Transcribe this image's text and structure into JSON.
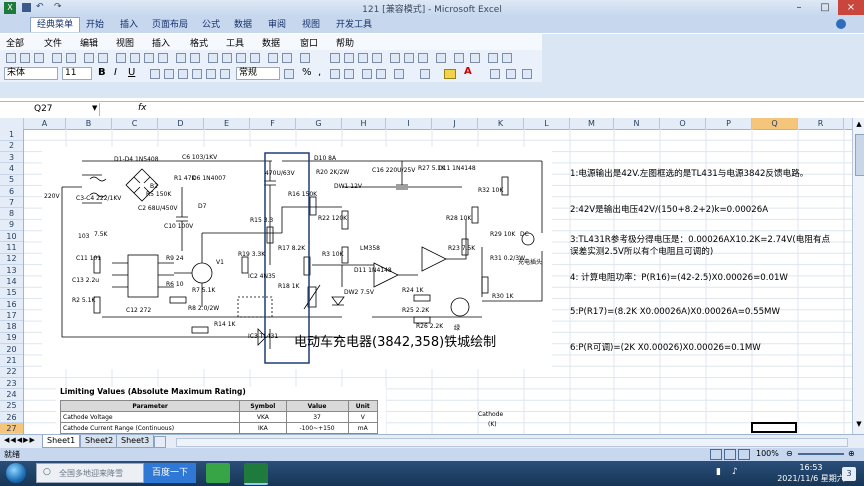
{
  "window": {
    "title": "121  [兼容模式] - Microsoft Excel",
    "controls": [
      "–",
      "□",
      "×"
    ]
  },
  "ribbon_tabs": [
    "经典菜单",
    "开始",
    "插入",
    "页面布局",
    "公式",
    "数据",
    "审阅",
    "视图",
    "开发工具"
  ],
  "classic_menu": [
    "全部",
    "文件",
    "编辑",
    "视图",
    "插入",
    "格式",
    "工具",
    "数据",
    "窗口",
    "帮助"
  ],
  "toolbar": {
    "font_name": "宋体",
    "font_size": "11",
    "bold": "B",
    "italic": "I",
    "underline": "U",
    "number_format": "常规",
    "percent": "%",
    "comma": ",",
    "font_color_letter": "A"
  },
  "formula_bar": {
    "name_box": "Q27",
    "fx": "fx",
    "value": ""
  },
  "columns": [
    "A",
    "B",
    "C",
    "D",
    "E",
    "F",
    "G",
    "H",
    "I",
    "J",
    "K",
    "L",
    "M",
    "N",
    "O",
    "P",
    "Q",
    "R"
  ],
  "selected_column": "Q",
  "rows": [
    "1",
    "2",
    "3",
    "4",
    "5",
    "6",
    "7",
    "8",
    "9",
    "10",
    "11",
    "12",
    "13",
    "14",
    "15",
    "16",
    "17",
    "18",
    "19",
    "20",
    "21",
    "22",
    "23",
    "24",
    "25",
    "26",
    "27"
  ],
  "notes": [
    "1:电源输出是42V.左图框选的是TL431与电源3842反馈电路。",
    "2:42V是输出电压42V/(150+8.2+2)k=0.00026A",
    "3:TL431R参考极分得电压是：0.00026AX10.2K=2.74V(电阻有点",
    "误差实测2.5V所以有个电阻且可调的)",
    "4: 计算电阻功率：P(R16)=(42-2.5)X0.00026=0.01W",
    "5:P(R17)=(8.2K X0.00026A)X0.00026A=0.55MW",
    "6:P(R可调)=(2K X0.00026)X0.00026=0.1MW"
  ],
  "schematic": {
    "caption": "电动车充电器(3842,358)铁城绘制",
    "labels": [
      "220V",
      "D1-D4 1N5408",
      "C6 103/1KV",
      "470U/63V",
      "D10 8A",
      "R20 2K/2W",
      "C16 220U/25V",
      "R27 5.1K",
      "D11 1N4148",
      "R32 10K",
      "R28 10K",
      "C3-C4 222/1KV",
      "B2",
      "R1 47K",
      "R5 150K",
      "D6 1N4007",
      "C2 68U/450V",
      "C10 100V",
      "D7",
      "R16 150K",
      "DW1 12V",
      "R15 3.3",
      "R17 8.2K",
      "R22 120K",
      "LM358",
      "R29 10K",
      "DC",
      "R31 0.2/3W",
      "充电插头",
      "103",
      "7.5K",
      "C11 101",
      "R9 24",
      "V1",
      "R19 3.3K",
      "R6 10",
      "R7 5.1K",
      "R8 2.0/2W",
      "IC2 4N35",
      "R18 1K",
      "R14 1K",
      "C13 2.2u",
      "R2 5.1K",
      "C12 272",
      "IC3 TL431",
      "DW2 7.5V",
      "D11 1N4148",
      "R24 1K",
      "R25 2.2K",
      "R23 7.5K",
      "R30 1K",
      "R3 10K",
      "R26 2.2K",
      "绿"
    ]
  },
  "limiting_values": {
    "title": "Limiting Values (Absolute Maximum Rating)",
    "headers": [
      "Parameter",
      "Symbol",
      "Value",
      "Unit"
    ],
    "rows": [
      [
        "Cathode Voltage",
        "VKA",
        "37",
        "V"
      ],
      [
        "Cathode Current Range (Continuous)",
        "IKA",
        "-100~+150",
        "mA"
      ]
    ],
    "cathode_label": "Cathode",
    "cathode_k": "(K)"
  },
  "sheet_tabs": [
    "Sheet1",
    "Sheet2",
    "Sheet3"
  ],
  "status": {
    "mode": "就绪",
    "zoom": "100%"
  },
  "taskbar": {
    "search_placeholder": "全国多地迎来降雪",
    "baidu_button": "百度一下",
    "time": "16:53",
    "date": "2021/11/6 星期六",
    "notification_count": "3"
  },
  "colors": {
    "ribbon_bg": "#c6d7ee",
    "selection": "#f6c57c",
    "highlight_box": "#1f3d7a",
    "taskbar": "#173556"
  }
}
